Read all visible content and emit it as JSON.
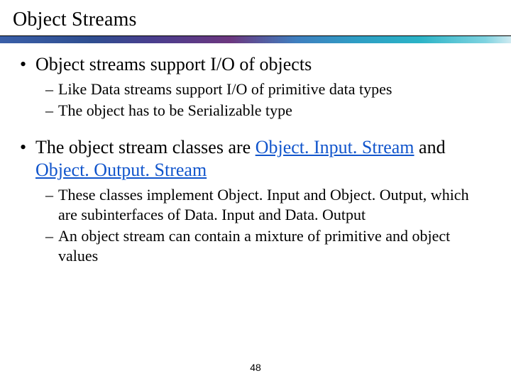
{
  "title": "Object Streams",
  "b1": {
    "text": "Object streams support I/O of objects",
    "s1": "Like Data streams support I/O of primitive data types",
    "s2": "The object has to be Serializable type"
  },
  "b2": {
    "pre": "The object stream classes are ",
    "link1": "Object. Input. Stream",
    "mid": " and ",
    "link2": "Object. Output. Stream",
    "s1": "These classes implement Object. Input and Object. Output, which are subinterfaces of Data. Input and Data. Output",
    "s2": "An object stream can contain a mixture of primitive and object values"
  },
  "page": "48"
}
